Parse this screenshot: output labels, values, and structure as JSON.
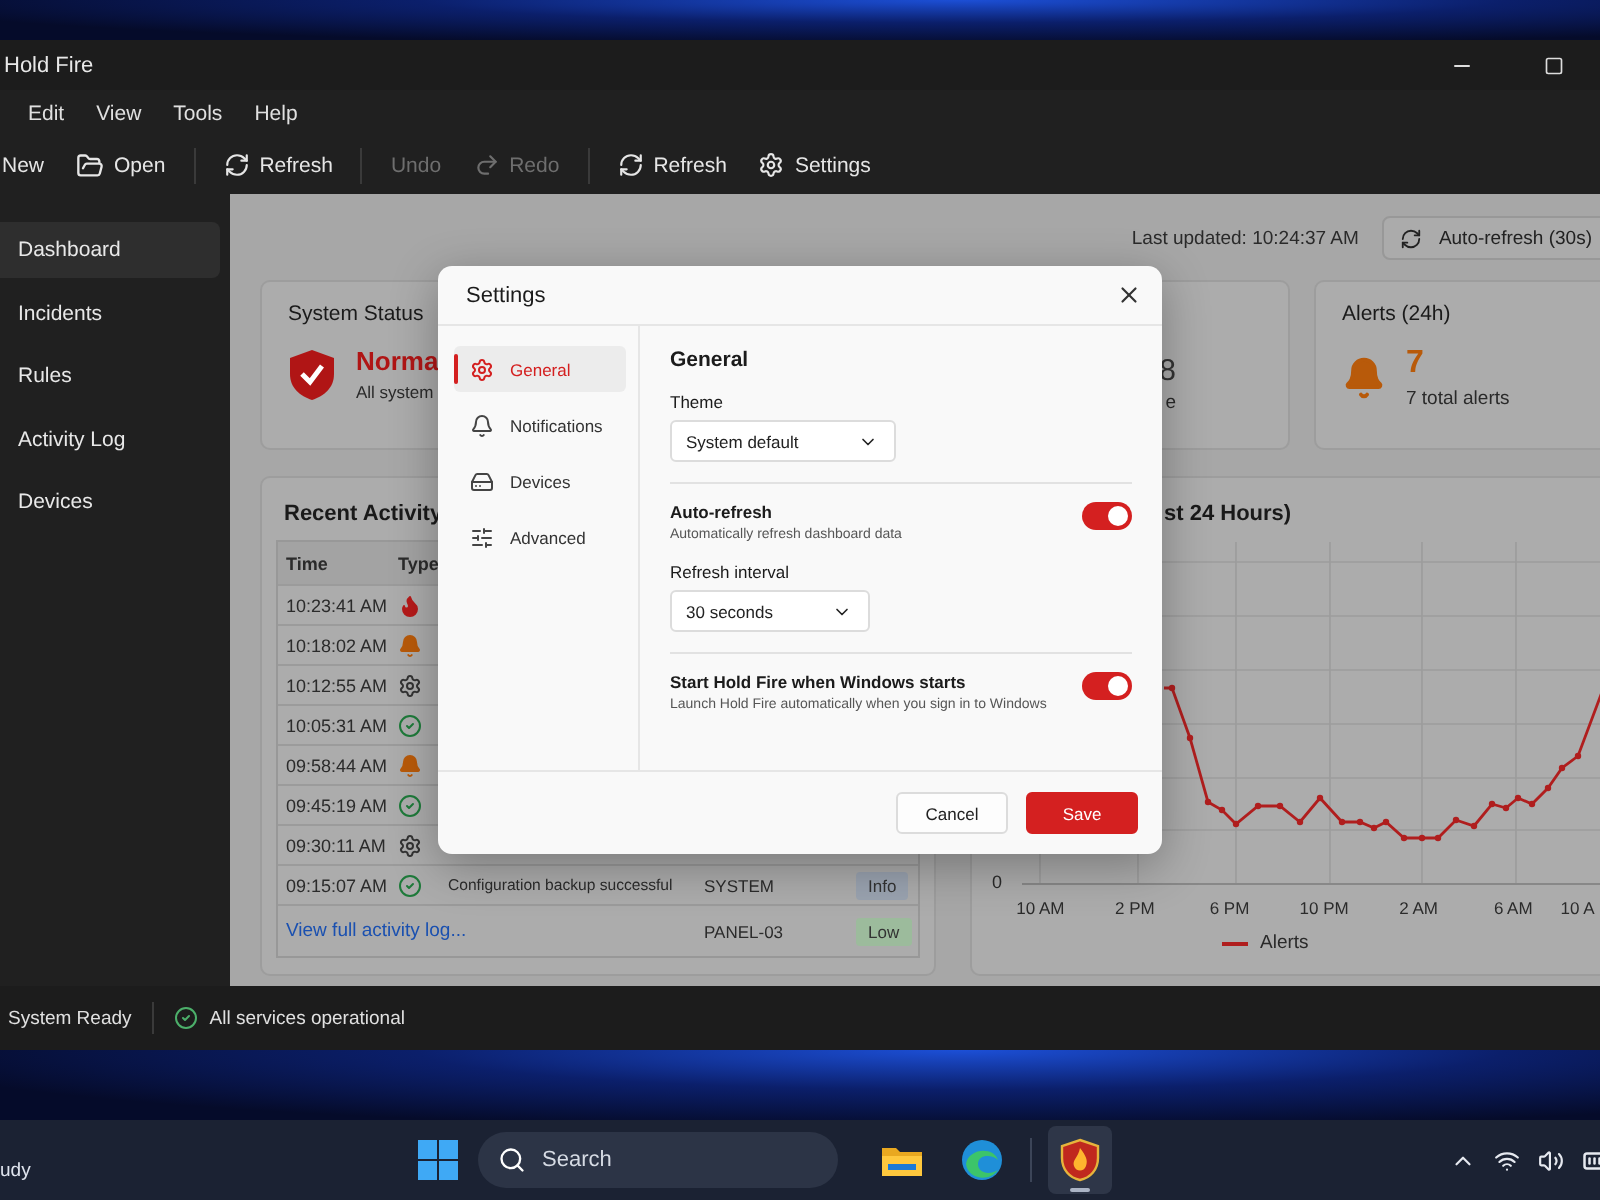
{
  "window": {
    "title": "Hold Fire"
  },
  "menu": [
    "Edit",
    "View",
    "Tools",
    "Help"
  ],
  "toolbar": [
    {
      "kind": "plain",
      "label": "New",
      "disabled": false
    },
    {
      "kind": "folder",
      "label": "Open",
      "disabled": false
    },
    {
      "kind": "separator"
    },
    {
      "kind": "refresh",
      "label": "Refresh",
      "disabled": false
    },
    {
      "kind": "separator"
    },
    {
      "kind": "plain",
      "label": "Undo",
      "disabled": true
    },
    {
      "kind": "redo",
      "label": "Redo",
      "disabled": true
    },
    {
      "kind": "separator"
    },
    {
      "kind": "refresh",
      "label": "Refresh",
      "disabled": false
    },
    {
      "kind": "gear",
      "label": "Settings",
      "disabled": false
    }
  ],
  "sidebar": {
    "items": [
      {
        "label": "Dashboard",
        "selected": true
      },
      {
        "label": "Incidents",
        "selected": false
      },
      {
        "label": "Rules",
        "selected": false
      },
      {
        "label": "Activity Log",
        "selected": false
      },
      {
        "label": "Devices",
        "selected": false
      }
    ]
  },
  "header": {
    "last_updated": "Last updated: 10:24:37 AM",
    "auto_refresh_button": "Auto-refresh (30s)"
  },
  "cards": {
    "system_status": {
      "title": "System Status",
      "value": "Norma",
      "detail": "All system"
    },
    "middle": {
      "value": "8",
      "detail": "e"
    },
    "alerts": {
      "title": "Alerts (24h)",
      "value": "7",
      "detail": "7 total alerts"
    }
  },
  "recent_activity": {
    "title": "Recent Activity",
    "columns": [
      "Time",
      "Type"
    ],
    "rows": [
      {
        "time": "10:23:41 AM",
        "kind": "fire"
      },
      {
        "time": "10:18:02 AM",
        "kind": "alert"
      },
      {
        "time": "10:12:55 AM",
        "kind": "config"
      },
      {
        "time": "10:05:31 AM",
        "kind": "success"
      },
      {
        "time": "09:58:44 AM",
        "kind": "alert"
      },
      {
        "time": "09:45:19 AM",
        "kind": "success"
      },
      {
        "time": "09:30:11 AM",
        "kind": "config"
      },
      {
        "time": "09:15:07 AM",
        "kind": "success",
        "message": "Configuration backup successful",
        "source": "SYSTEM",
        "severity": "Info",
        "color": "#9aa3b0"
      },
      {
        "link": "View full activity log...",
        "source": "PANEL-03",
        "severity": "Low",
        "color": "#9cbb9c"
      }
    ]
  },
  "chart": {
    "title": "st 24 Hours)",
    "y_label": "0",
    "x_labels": [
      "10 AM",
      "2 PM",
      "6 PM",
      "10 PM",
      "2 AM",
      "6 AM",
      "10 A"
    ],
    "legend": "Alerts"
  },
  "settings_dialog": {
    "title": "Settings",
    "nav": [
      {
        "kind": "gear",
        "label": "General",
        "selected": true
      },
      {
        "kind": "bell",
        "label": "Notifications",
        "selected": false
      },
      {
        "kind": "device",
        "label": "Devices",
        "selected": false
      },
      {
        "kind": "sliders",
        "label": "Advanced",
        "selected": false
      }
    ],
    "section_title": "General",
    "settings": [
      {
        "kind": "select",
        "label": "Theme",
        "value": "System default"
      },
      {
        "kind": "toggle",
        "label": "Auto-refresh",
        "description": "Automatically refresh dashboard data",
        "on": true
      },
      {
        "kind": "select",
        "label": "Refresh interval",
        "value": "30 seconds"
      },
      {
        "kind": "toggle",
        "label": "Start Hold Fire when Windows starts",
        "description": "Launch Hold Fire automatically when you sign in to Windows",
        "on": true
      }
    ],
    "buttons": [
      {
        "kind": "secondary",
        "label": "Cancel"
      },
      {
        "kind": "primary",
        "label": "Save"
      }
    ]
  },
  "status_bar": {
    "status": "System Ready",
    "services": "All services operational"
  },
  "taskbar": {
    "weather": "udy",
    "search_placeholder": "Search",
    "apps": [
      {
        "kind": "folder",
        "active": false
      },
      {
        "kind": "edge",
        "active": false
      },
      {
        "kind": "app",
        "active": true
      }
    ]
  }
}
